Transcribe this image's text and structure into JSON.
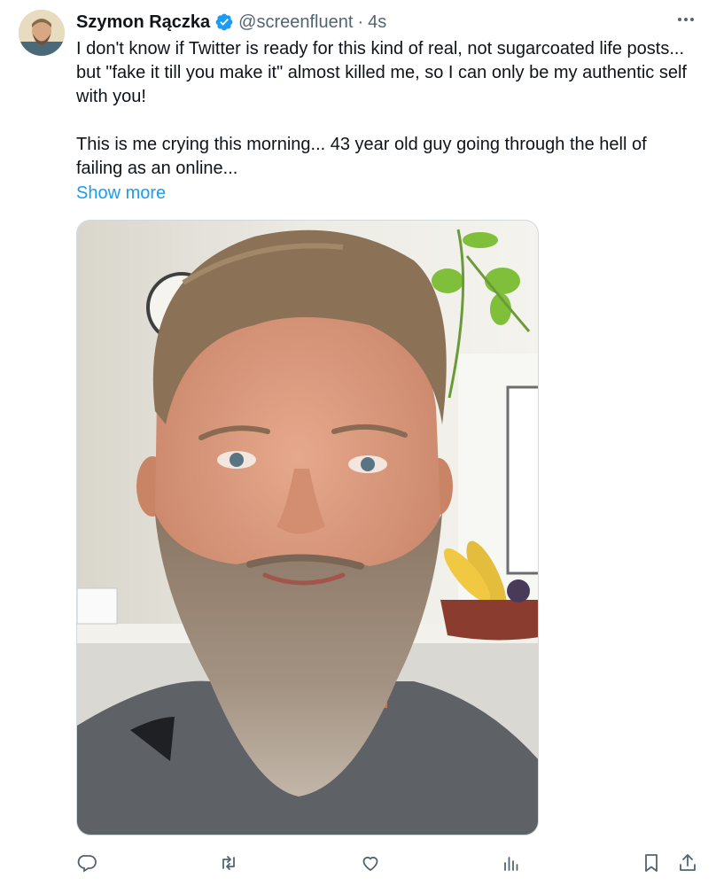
{
  "author": {
    "display_name": "Szymon Rączka",
    "handle": "@screenfluent",
    "separator": "·",
    "time": "4s",
    "verified": true
  },
  "tweet": {
    "text": "I don't know if Twitter is ready for this kind of real, not sugarcoated life posts... but \"fake it till you make it\" almost killed me, so I can only be my authentic self with you!\n\nThis is me crying this morning... 43 year old guy going through the hell of failing as an online...",
    "show_more": "Show more"
  },
  "icons": {
    "more": "more-horizontal-icon",
    "reply": "reply-icon",
    "retweet": "retweet-icon",
    "like": "like-icon",
    "views": "views-icon",
    "bookmark": "bookmark-icon",
    "share": "share-icon"
  },
  "colors": {
    "link": "#1d9bf0",
    "verified": "#1d9bf0",
    "secondary_text": "#536471",
    "icon": "#536471"
  }
}
